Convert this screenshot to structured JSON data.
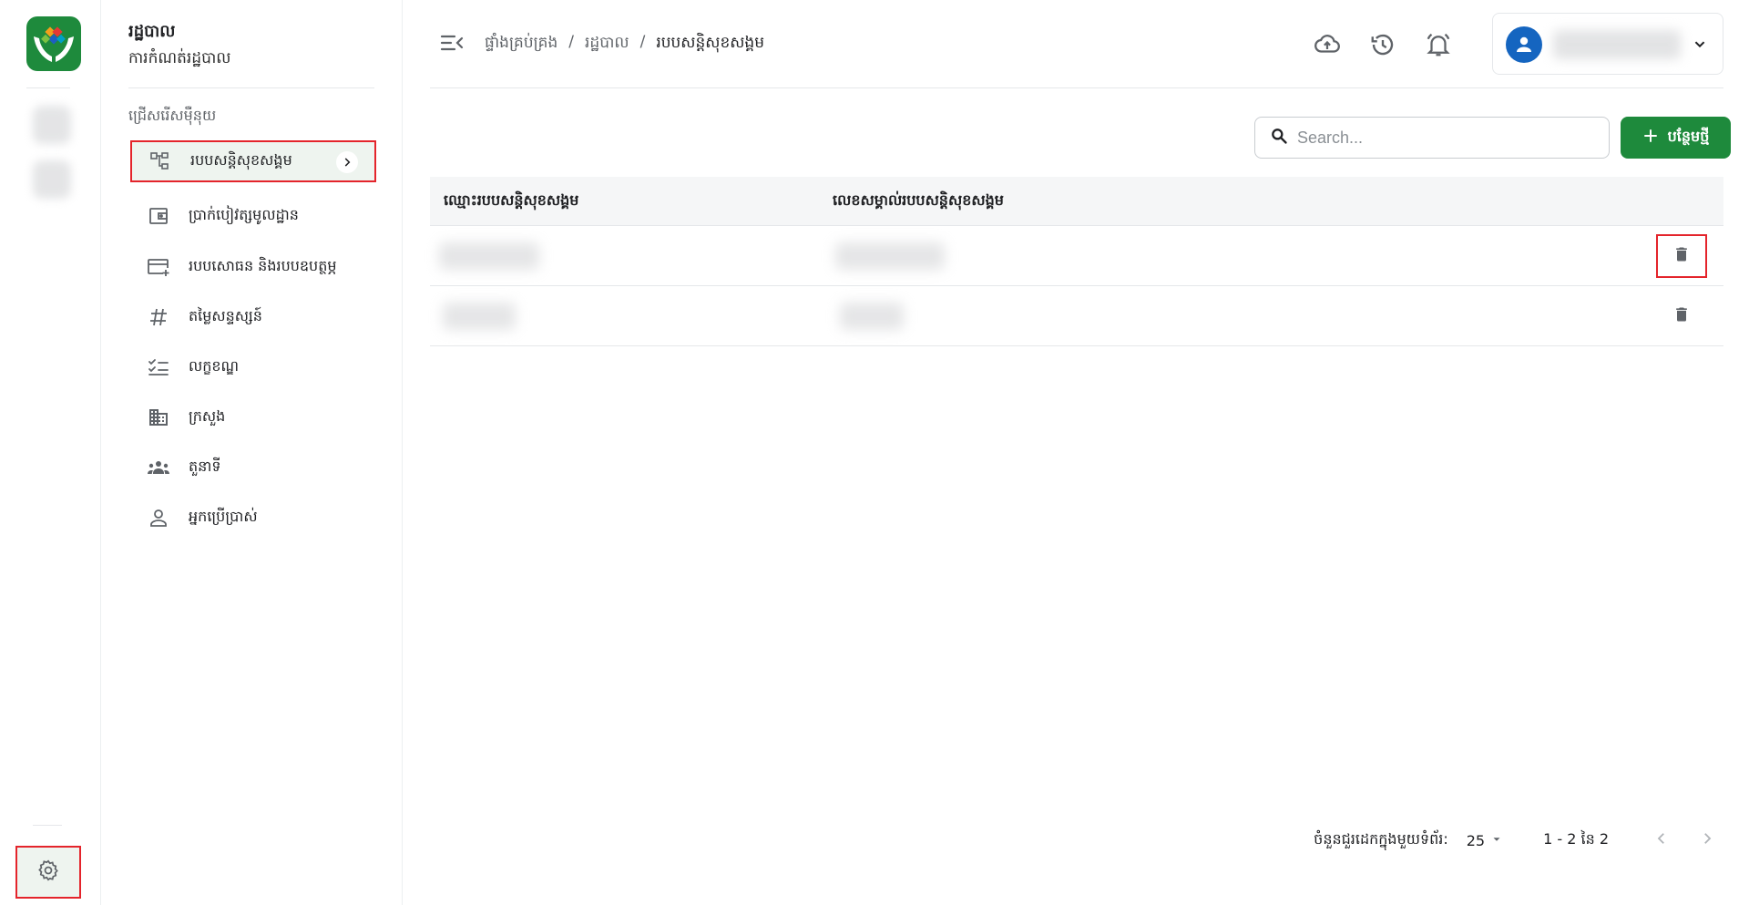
{
  "menu": {
    "title": "រដ្ឋបាល",
    "subtitle": "ការកំណត់រដ្ឋបាល",
    "section_label": "ជ្រើសរើសម៉ឺនុយ",
    "items": [
      {
        "label": "របបសន្តិសុខសង្គម",
        "icon": "hierarchy-icon"
      },
      {
        "label": "ប្រាក់បៀវត្សមូលដ្ឋាន",
        "icon": "wallet-icon"
      },
      {
        "label": "របបសោធន និងរបបឧបត្ថម្ភ",
        "icon": "card-add-icon"
      },
      {
        "label": "តម្លៃសន្ទស្សន៍",
        "icon": "hash-icon"
      },
      {
        "label": "លក្ខខណ្ឌ",
        "icon": "checklist-icon"
      },
      {
        "label": "ក្រសួង",
        "icon": "building-icon"
      },
      {
        "label": "តួនាទី",
        "icon": "group-icon"
      },
      {
        "label": "អ្នកប្រើប្រាស់",
        "icon": "person-icon"
      }
    ]
  },
  "breadcrumb": {
    "home": "ផ្ទាំងគ្រប់គ្រង",
    "parent": "រដ្ឋបាល",
    "current": "របបសន្តិសុខសង្គម",
    "separator": "/"
  },
  "toolbar": {
    "search_placeholder": "Search...",
    "add_label": "បន្ថែមថ្មី"
  },
  "table": {
    "columns": [
      "ឈ្មោះរបបសន្តិសុខសង្គម",
      "លេខសម្គាល់របបសន្តិសុខសង្គម"
    ]
  },
  "pagination": {
    "rows_label": "ចំនួនជួរដេកក្នុងមួយទំព័រ:",
    "rows_per_page": "25",
    "range": "1 - 2 នៃ 2"
  },
  "colors": {
    "brand_green": "#1e8a3c",
    "highlight_red": "#e4242b",
    "avatar_blue": "#1565c0"
  }
}
